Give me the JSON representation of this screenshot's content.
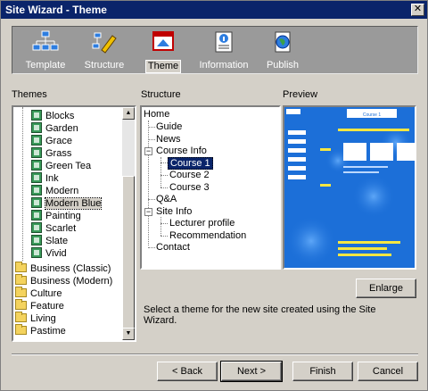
{
  "window": {
    "title": "Site Wizard - Theme"
  },
  "toolbar": {
    "items": [
      {
        "label": "Template",
        "icon": "sitemap-icon"
      },
      {
        "label": "Structure",
        "icon": "structure-pencil-icon"
      },
      {
        "label": "Theme",
        "icon": "theme-window-icon",
        "active": true
      },
      {
        "label": "Information",
        "icon": "information-document-icon"
      },
      {
        "label": "Publish",
        "icon": "globe-document-icon"
      }
    ]
  },
  "themes": {
    "label": "Themes",
    "items": [
      "Blocks",
      "Garden",
      "Grace",
      "Grass",
      "Green Tea",
      "Ink",
      "Modern",
      "Modern Blue",
      "Painting",
      "Scarlet",
      "Slate",
      "Vivid"
    ],
    "selected": "Modern Blue",
    "folders": [
      "Business (Classic)",
      "Business (Modern)",
      "Culture",
      "Feature",
      "Living",
      "Pastime"
    ]
  },
  "structure": {
    "label": "Structure",
    "root": "Home",
    "guide": "Guide",
    "news": "News",
    "course_info": "Course Info",
    "course1": "Course 1",
    "course2": "Course 2",
    "course3": "Course 3",
    "qa": "Q&A",
    "site_info": "Site Info",
    "lecturer": "Lecturer profile",
    "recommendation": "Recommendation",
    "contact": "Contact"
  },
  "preview": {
    "label": "Preview",
    "banner_text": "Course 1"
  },
  "enlarge_label": "Enlarge",
  "hint": "Select a theme for the new site created using the Site Wizard.",
  "buttons": {
    "back": "< Back",
    "next": "Next >",
    "finish": "Finish",
    "cancel": "Cancel"
  },
  "colors": {
    "titlebar": "#0a246a",
    "preview_bg": "#1c6fd8",
    "preview_accent": "#f5e642"
  }
}
